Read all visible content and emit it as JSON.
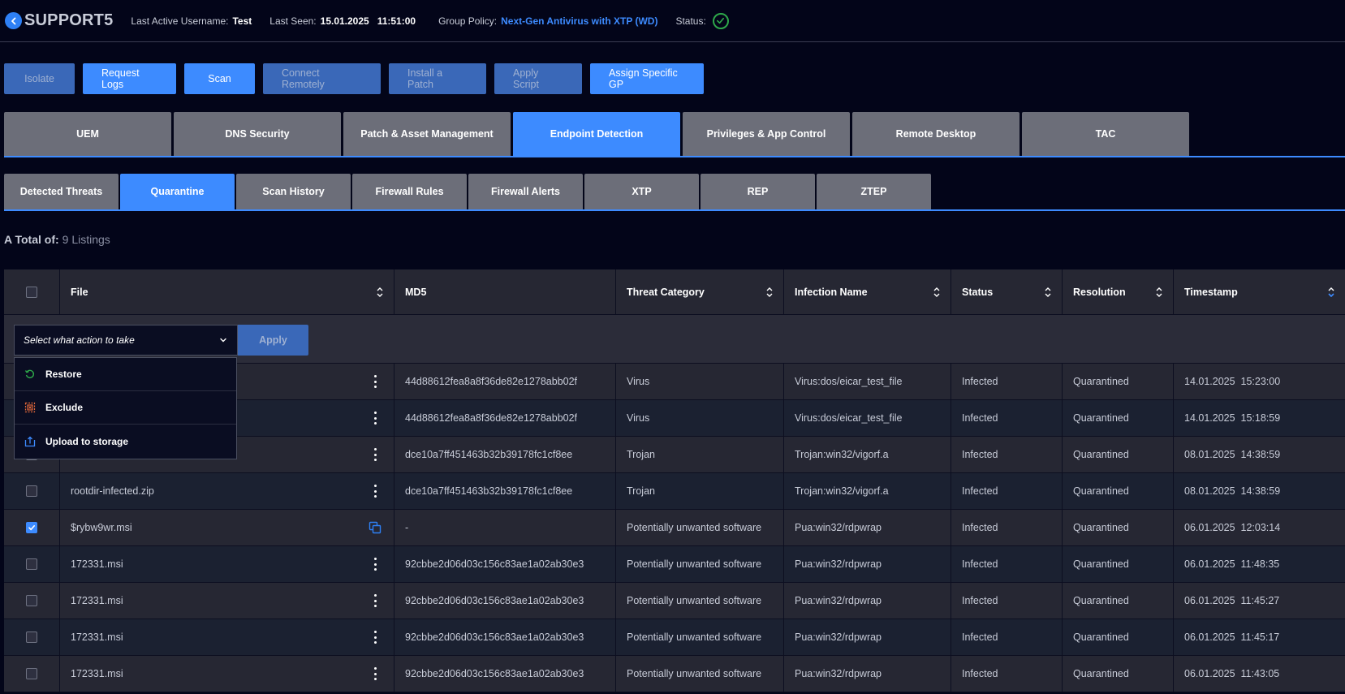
{
  "header": {
    "hostname": "SUPPORT5",
    "last_active_label": "Last Active Username:",
    "last_active_value": "Test",
    "last_seen_label": "Last Seen:",
    "last_seen_value": "15.01.2025   11:51:00",
    "group_policy_label": "Group Policy:",
    "group_policy_value": "Next-Gen Antivirus with XTP (WD)",
    "status_label": "Status:"
  },
  "actions": {
    "isolate": "Isolate",
    "request_logs": "Request Logs",
    "scan": "Scan",
    "connect_remotely": "Connect Remotely",
    "install_patch": "Install a Patch",
    "apply_script": "Apply Script",
    "assign_gp": "Assign Specific GP"
  },
  "main_tabs": [
    "UEM",
    "DNS Security",
    "Patch & Asset Management",
    "Endpoint Detection",
    "Privileges & App Control",
    "Remote Desktop",
    "TAC"
  ],
  "sub_tabs": [
    "Detected Threats",
    "Quarantine",
    "Scan History",
    "Firewall Rules",
    "Firewall Alerts",
    "XTP",
    "REP",
    "ZTEP"
  ],
  "total": {
    "label": "A Total of:",
    "count": "9 Listings"
  },
  "table": {
    "columns": [
      "File",
      "MD5",
      "Threat Category",
      "Infection Name",
      "Status",
      "Resolution",
      "Timestamp"
    ],
    "action_select_placeholder": "Select what action to take",
    "apply_label": "Apply",
    "rows": [
      {
        "file": "",
        "md5": "44d88612fea8a8f36de82e1278abb02f",
        "category": "Virus",
        "infection": "Virus:dos/eicar_test_file",
        "status": "Infected",
        "resolution": "Quarantined",
        "timestamp": "14.01.2025  15:23:00"
      },
      {
        "file": "",
        "md5": "44d88612fea8a8f36de82e1278abb02f",
        "category": "Virus",
        "infection": "Virus:dos/eicar_test_file",
        "status": "Infected",
        "resolution": "Quarantined",
        "timestamp": "14.01.2025  15:18:59"
      },
      {
        "file": "",
        "md5": "dce10a7ff451463b32b39178fc1cf8ee",
        "category": "Trojan",
        "infection": "Trojan:win32/vigorf.a",
        "status": "Infected",
        "resolution": "Quarantined",
        "timestamp": "08.01.2025  14:38:59"
      },
      {
        "file": "rootdir-infected.zip",
        "md5": "dce10a7ff451463b32b39178fc1cf8ee",
        "category": "Trojan",
        "infection": "Trojan:win32/vigorf.a",
        "status": "Infected",
        "resolution": "Quarantined",
        "timestamp": "08.01.2025  14:38:59"
      },
      {
        "file": "$rybw9wr.msi",
        "md5": "-",
        "category": "Potentially unwanted software",
        "infection": "Pua:win32/rdpwrap",
        "status": "Infected",
        "resolution": "Quarantined",
        "timestamp": "06.01.2025  12:03:14"
      },
      {
        "file": "172331.msi",
        "md5": "92cbbe2d06d03c156c83ae1a02ab30e3",
        "category": "Potentially unwanted software",
        "infection": "Pua:win32/rdpwrap",
        "status": "Infected",
        "resolution": "Quarantined",
        "timestamp": "06.01.2025  11:48:35"
      },
      {
        "file": "172331.msi",
        "md5": "92cbbe2d06d03c156c83ae1a02ab30e3",
        "category": "Potentially unwanted software",
        "infection": "Pua:win32/rdpwrap",
        "status": "Infected",
        "resolution": "Quarantined",
        "timestamp": "06.01.2025  11:45:27"
      },
      {
        "file": "172331.msi",
        "md5": "92cbbe2d06d03c156c83ae1a02ab30e3",
        "category": "Potentially unwanted software",
        "infection": "Pua:win32/rdpwrap",
        "status": "Infected",
        "resolution": "Quarantined",
        "timestamp": "06.01.2025  11:45:17"
      },
      {
        "file": "172331.msi",
        "md5": "92cbbe2d06d03c156c83ae1a02ab30e3",
        "category": "Potentially unwanted software",
        "infection": "Pua:win32/rdpwrap",
        "status": "Infected",
        "resolution": "Quarantined",
        "timestamp": "06.01.2025  11:43:05"
      }
    ]
  },
  "dropdown": {
    "restore": "Restore",
    "exclude": "Exclude",
    "upload": "Upload to storage"
  },
  "colors": {
    "accent": "#3d8bff",
    "background": "#030519",
    "status_ok": "#2ea84a",
    "tab_inactive": "#6c6e79"
  }
}
